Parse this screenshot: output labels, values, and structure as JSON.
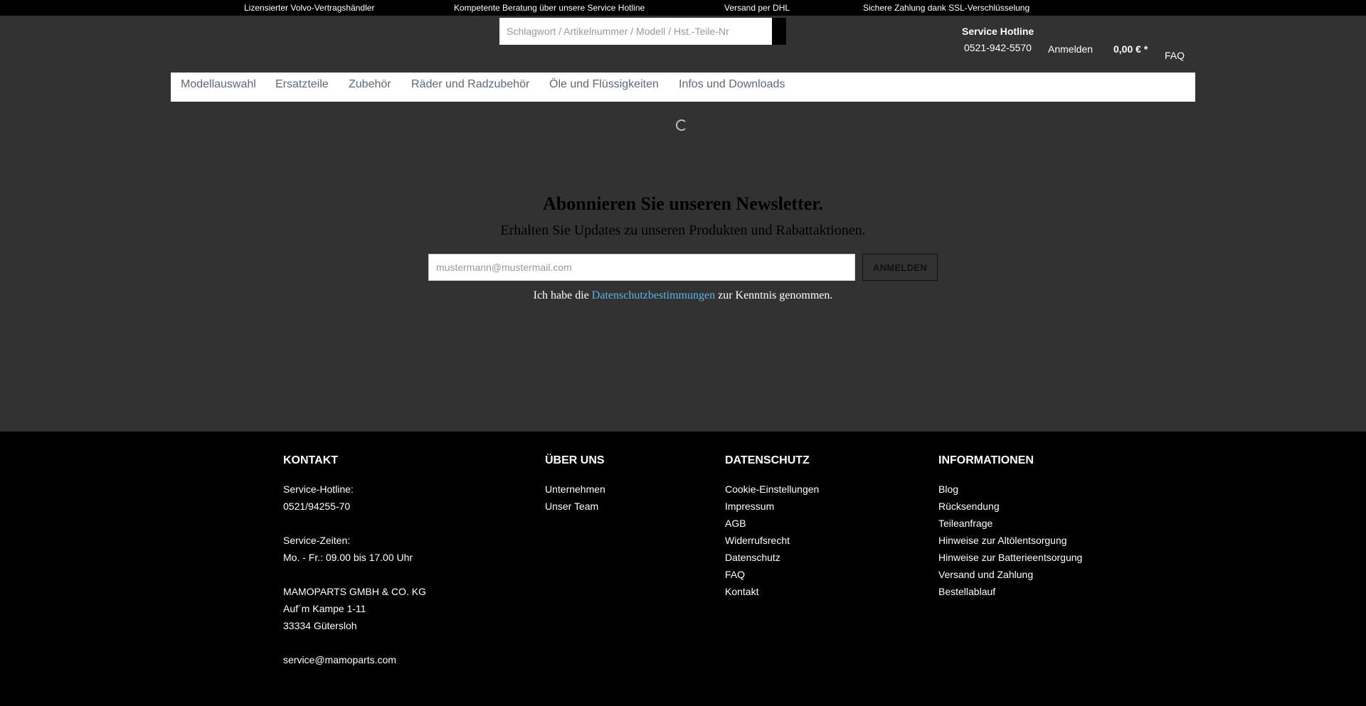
{
  "topbar": {
    "items": [
      "Lizensierter Volvo-Vertragshändler",
      "Kompetente Beratung über unsere Service Hotline",
      "Versand per DHL",
      "Sichere Zahlung dank SSL-Verschlüsselung"
    ]
  },
  "header": {
    "search_placeholder": "Schlagwort / Artikelnummer / Modell / Hst.-Teile-Nr",
    "search_icon": "search-icon",
    "hotline_title": "Service Hotline",
    "hotline_number": "0521-942-5570",
    "login_label": "Anmelden",
    "cart_total": "0,00 € *",
    "faq_label": "FAQ"
  },
  "nav": {
    "items": [
      "Modellauswahl",
      "Ersatzteile",
      "Zubehör",
      "Räder und Radzubehör",
      "Öle und Flüssigkeiten",
      "Infos und Downloads"
    ]
  },
  "newsletter": {
    "title": "Abonnieren Sie unseren Newsletter.",
    "subtitle": "Erhalten Sie Updates zu unseren Produkten und Rabattaktionen.",
    "email_placeholder": "mustermann@mustermail.com",
    "submit_label": "ANMELDEN",
    "consent_before": "Ich habe die ",
    "consent_link": "Datenschutzbestimmungen",
    "consent_after": " zur Kenntnis genommen."
  },
  "footer": {
    "kontakt": {
      "title": "KONTAKT",
      "hotline_label": "Service-Hotline:",
      "hotline_number": "0521/94255-70",
      "hours_label": "Service-Zeiten:",
      "hours": "Mo. - Fr.: 09.00 bis 17.00 Uhr",
      "company": "MAMOPARTS GMBH & CO. KG",
      "street": "Auf´m Kampe 1-11",
      "city": "33334 Gütersloh",
      "email": "service@mamoparts.com"
    },
    "ueber_uns": {
      "title": "ÜBER UNS",
      "links": [
        "Unternehmen",
        "Unser Team"
      ]
    },
    "datenschutz": {
      "title": "DATENSCHUTZ",
      "links": [
        "Cookie-Einstellungen",
        "Impressum",
        "AGB",
        "Widerrufsrecht",
        "Datenschutz",
        "FAQ",
        "Kontakt"
      ]
    },
    "informationen": {
      "title": "INFORMATIONEN",
      "links": [
        "Blog",
        "Rücksendung",
        "Teileanfrage",
        "Hinweise zur Altölentsorgung",
        "Hinweise zur Batterieentsorgung",
        "Versand und Zahlung",
        "Bestellablauf"
      ]
    }
  },
  "colors": {
    "page_bg": "#333233",
    "topbar_bg": "#000000",
    "footer_bg": "#000000",
    "nav_text": "#5f6873",
    "link_blue": "#5fb2e8"
  }
}
